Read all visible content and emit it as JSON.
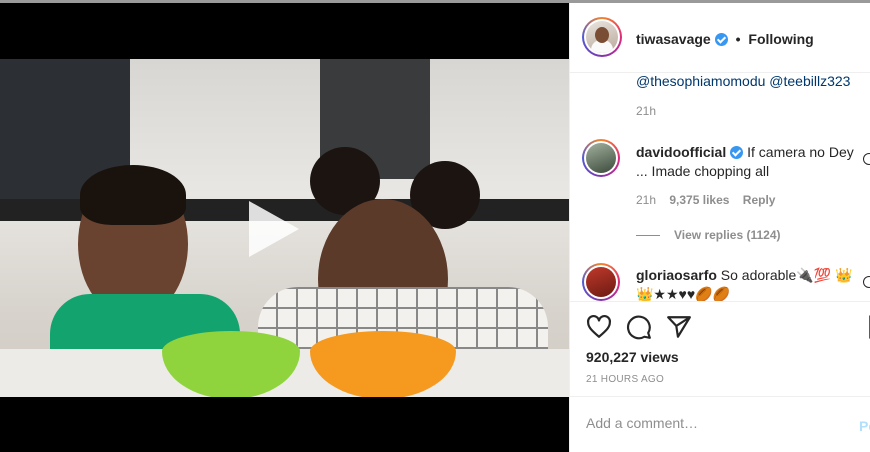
{
  "post": {
    "username": "tiwasavage",
    "separator": "•",
    "follow_label": "Following"
  },
  "comments": {
    "mention_1": "@thesophiamomodu",
    "mention_2": "@teebillz323",
    "first_time": "21h",
    "items": [
      {
        "username": "davidoofficial",
        "text": "If camera no Dey ... Imade chopping all",
        "time": "21h",
        "likes": "9,375 likes",
        "reply_label": "Reply",
        "view_replies": "View replies (1124)"
      },
      {
        "username": "gloriaosarfo",
        "text": "So adorable🔌💯 👑👑★★♥♥🏉🏉"
      }
    ]
  },
  "stats": {
    "views": "920,227 views",
    "posted_ago": "21 HOURS AGO"
  },
  "composer": {
    "placeholder": "Add a comment…",
    "post_label": "Post"
  },
  "icons": [
    "play-icon",
    "verified-badge-icon",
    "heart-icon",
    "comment-icon",
    "share-icon",
    "bookmark-icon"
  ],
  "colors": {
    "link": "#00376b",
    "verified": "#3897f0",
    "muted": "#8e8e8e",
    "post_disabled": "#b2dffc"
  }
}
